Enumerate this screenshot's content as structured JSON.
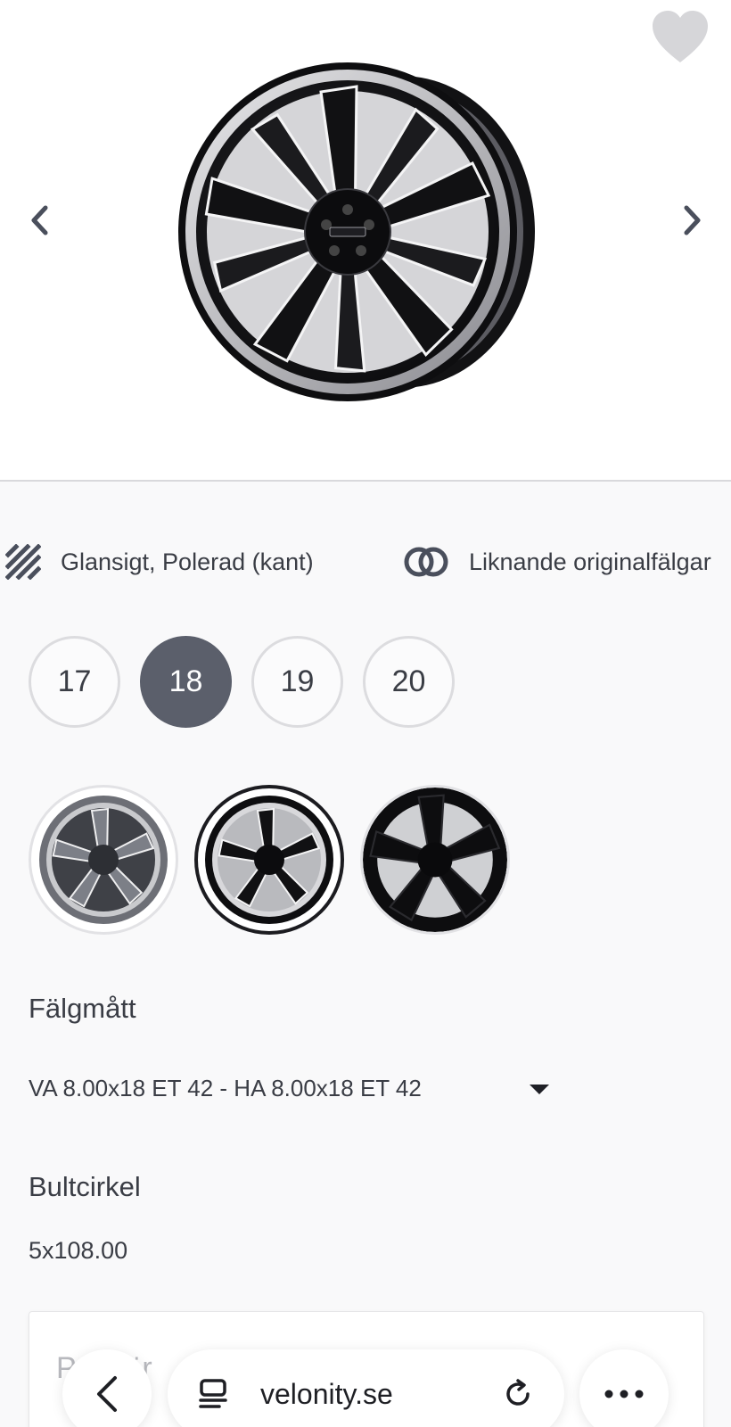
{
  "hero": {
    "favorite_icon": "heart-icon",
    "prev_icon": "chevron-left-icon",
    "next_icon": "chevron-right-icon",
    "image": "wheel-black-polished"
  },
  "attributes": {
    "finish": {
      "icon": "stripes-icon",
      "label": "Glansigt, Polerad (kant)"
    },
    "similar": {
      "icon": "linked-rings-icon",
      "label": "Liknande originalfälgar"
    }
  },
  "sizes": {
    "options": [
      "17",
      "18",
      "19",
      "20"
    ],
    "selected": "18"
  },
  "variants": {
    "items": [
      "wheel-gunmetal-polished",
      "wheel-black-polished",
      "wheel-gloss-black"
    ],
    "selected_index": 1
  },
  "rim_dimensions": {
    "label": "Fälgmått",
    "value": "VA 8.00x18 ET 42 - HA 8.00x18 ET 42"
  },
  "bolt_pattern": {
    "label": "Bultcirkel",
    "value": "5x108.00"
  },
  "price_card": {
    "title": "Pris för"
  },
  "browser": {
    "url": "velonity.se",
    "back_icon": "back-arrow-icon",
    "tabs_icon": "tabs-icon",
    "reload_icon": "reload-icon",
    "more_icon": "more-dots-icon"
  },
  "colors": {
    "accent_selected": "#5b5f6b",
    "text": "#3a3d45",
    "background": "#f9f9fa"
  }
}
